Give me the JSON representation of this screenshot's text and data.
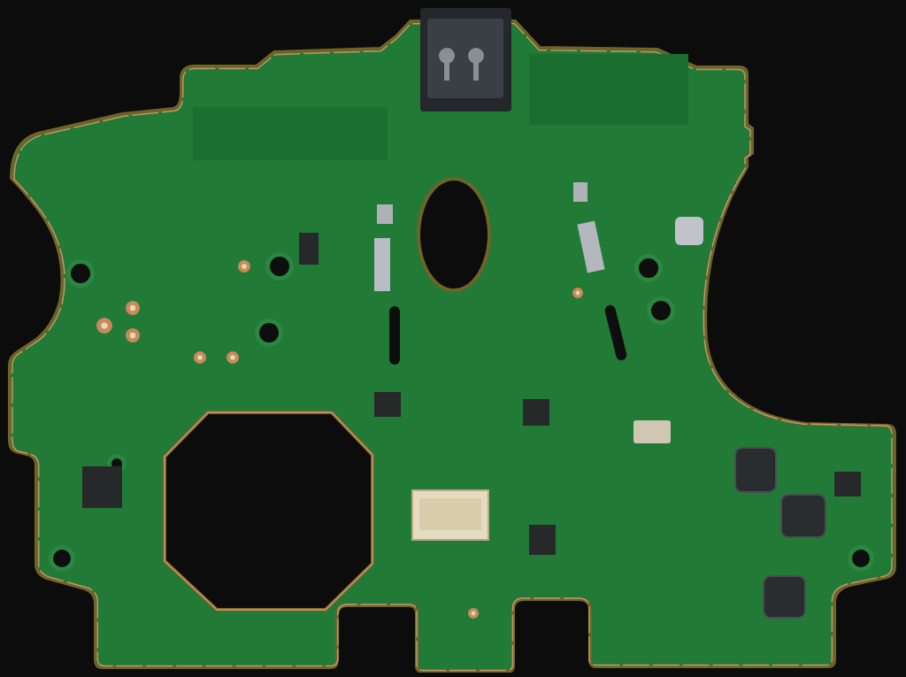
{
  "image": {
    "kind": "photo"
  }
}
